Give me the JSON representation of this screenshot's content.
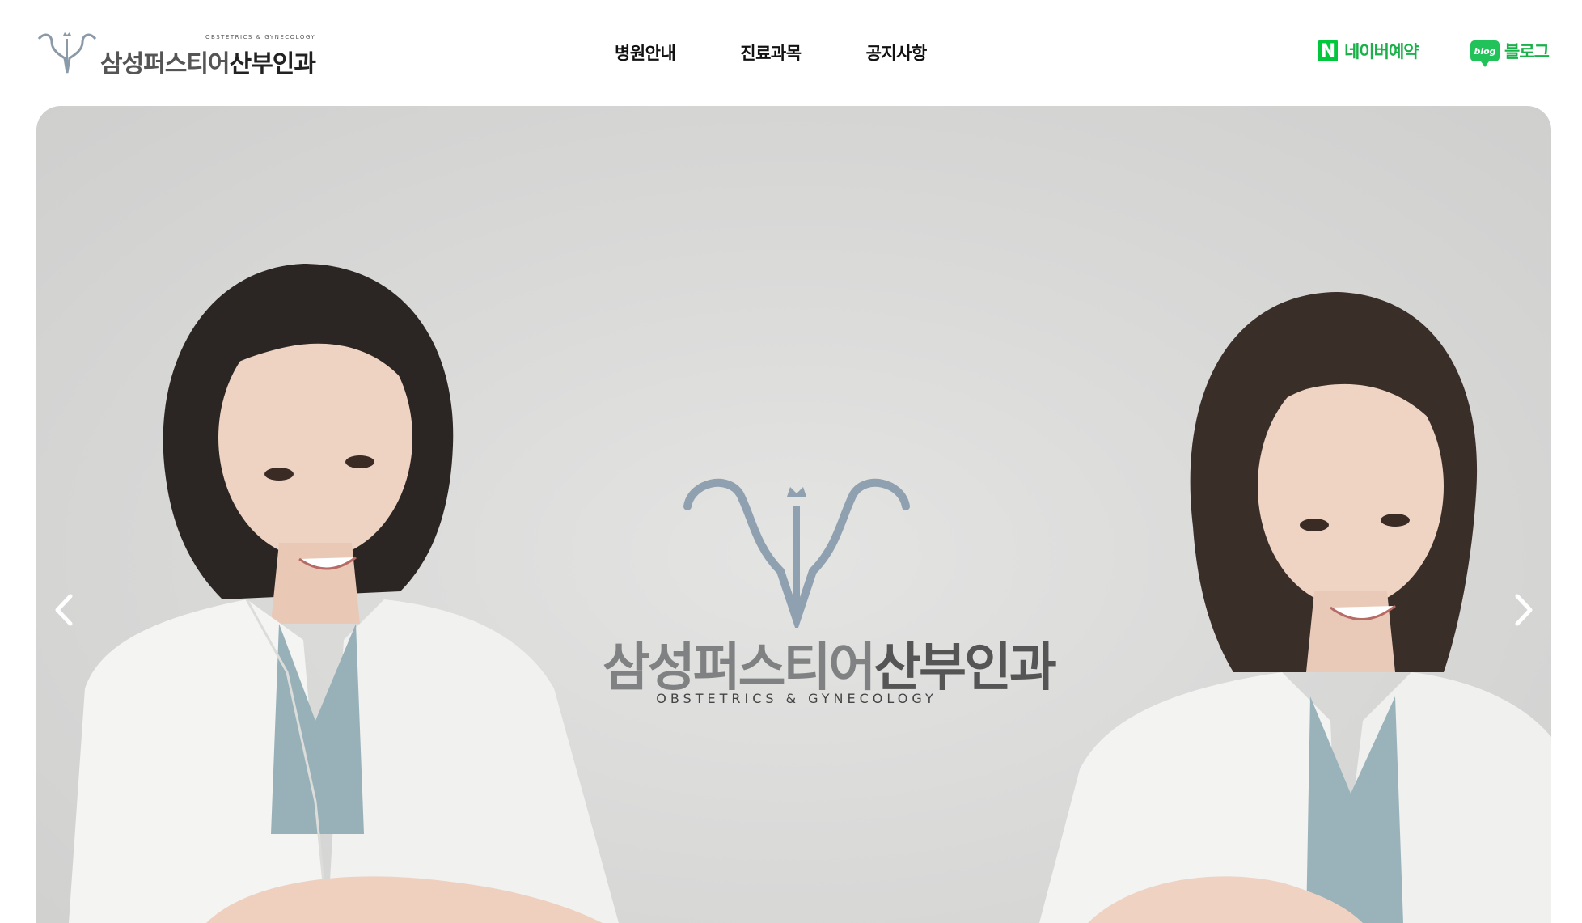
{
  "brand": {
    "name_part1": "삼성퍼스티어",
    "name_part2": "산부인과",
    "subtitle": "OBSTETRICS & GYNECOLOGY"
  },
  "nav": {
    "items": [
      "병원안내",
      "진료과목",
      "공지사항"
    ]
  },
  "external_links": {
    "naver": {
      "icon_letter": "N",
      "label": "네이버예약",
      "color": "#00c73c"
    },
    "blog": {
      "icon_text": "blog",
      "label": "블로그",
      "color": "#22c25b"
    }
  },
  "hero": {
    "logo_name_part1": "삼성퍼스티어",
    "logo_name_part2": "산부인과",
    "logo_subtitle": "OBSTETRICS & GYNECOLOGY",
    "prev_icon": "chevron-left-icon",
    "next_icon": "chevron-right-icon"
  }
}
